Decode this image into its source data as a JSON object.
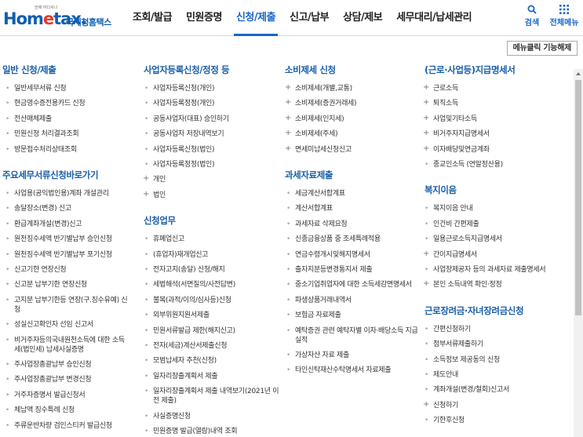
{
  "logo": {
    "tagline": "언제 어디서나",
    "main_prefix": "Hom",
    "main_accent": "e",
    "main_suffix": "tax.",
    "sub": "국세청홈택스"
  },
  "gnb": [
    "조회/발급",
    "민원증명",
    "신청/제출",
    "신고/납부",
    "상담/제보",
    "세무대리/납세관리"
  ],
  "gnb_active_index": 2,
  "utils": {
    "search": "검색",
    "all_menu": "전체메뉴"
  },
  "menu_click_button": "메뉴클릭 기능해제",
  "colors": {
    "brand": "#0f5fae",
    "accent_red": "#e8392b",
    "active": "#1a66c5",
    "section_title": "#1a5fa8"
  },
  "columns": [
    {
      "sections": [
        {
          "title": "일반 신청/제출",
          "items": [
            {
              "t": "일반세무서류 신청",
              "p": false
            },
            {
              "t": "현금영수증전용카드 신청",
              "p": false
            },
            {
              "t": "전산매체제출",
              "p": false
            },
            {
              "t": "민원신청 처리결과조회",
              "p": false
            },
            {
              "t": "방문접수처리상태조회",
              "p": false
            }
          ]
        },
        {
          "title": "주요세무서류신청바로가기",
          "items": [
            {
              "t": "사업용(공익법인용)계좌 개설관리",
              "p": false
            },
            {
              "t": "송달장소(변경) 신고",
              "p": false
            },
            {
              "t": "환급계좌개설(변경)신고",
              "p": false
            },
            {
              "t": "원천징수세액 반기별납부 승인신청",
              "p": false
            },
            {
              "t": "원천징수세액 반기별납부 포기신청",
              "p": false
            },
            {
              "t": "신고기한 연장신청",
              "p": false
            },
            {
              "t": "신고분 납부기한 연장신청",
              "p": false
            },
            {
              "t": "고지분 납부기한등 연장(구.징수유예) 신청",
              "p": false
            },
            {
              "t": "성실신고확인자 선임 신고서",
              "p": false
            },
            {
              "t": "비거주자등의국내원천소득에 대한 소득세(법인세) 납세사실증명",
              "p": false
            },
            {
              "t": "주사업장총괄납부 승인신청",
              "p": false
            },
            {
              "t": "주사업장총괄납부 변경신청",
              "p": false
            },
            {
              "t": "거주자증명서 발급신청서",
              "p": false
            },
            {
              "t": "체납액 징수특례 신청",
              "p": false
            },
            {
              "t": "주류운반차량 검인스티커 발급신청",
              "p": false
            }
          ]
        }
      ]
    },
    {
      "sections": [
        {
          "title": "사업자등록신청/정정 등",
          "items": [
            {
              "t": "사업자등록신청(개인)",
              "p": false
            },
            {
              "t": "사업자등록정정(개인)",
              "p": false
            },
            {
              "t": "공동사업자(대표) 승인하기",
              "p": false
            },
            {
              "t": "공동사업자 저장내역보기",
              "p": false
            },
            {
              "t": "사업자등록신청(법인)",
              "p": false
            },
            {
              "t": "사업자등록정정(법인)",
              "p": false
            },
            {
              "t": "개인",
              "p": true
            },
            {
              "t": "법인",
              "p": true
            }
          ]
        },
        {
          "title": "신청업무",
          "items": [
            {
              "t": "휴폐업신고",
              "p": false
            },
            {
              "t": "(휴업자)재개업신고",
              "p": false
            },
            {
              "t": "전자고지(송달) 신청/해지",
              "p": false
            },
            {
              "t": "세법해석(서면질의/사전답변)",
              "p": false
            },
            {
              "t": "불복(과적/이의/심사등)신청",
              "p": false
            },
            {
              "t": "외부위원지원서제출",
              "p": false
            },
            {
              "t": "민원서류발급 제한(해지신고)",
              "p": false
            },
            {
              "t": "전자(세금)계산서제출신청",
              "p": false
            },
            {
              "t": "모범납세자 추천(신청)",
              "p": false
            },
            {
              "t": "일자리창출계획서 제출",
              "p": false
            },
            {
              "t": "일자리창출계획서 제출 내역보기(2021년 이전 제출)",
              "p": false
            },
            {
              "t": "사실증명신청",
              "p": false
            },
            {
              "t": "민원증명 발급(열람)내역 조회",
              "p": false
            }
          ]
        }
      ]
    },
    {
      "sections": [
        {
          "title": "소비제세 신청",
          "items": [
            {
              "t": "소비제세(개별,교통)",
              "p": true
            },
            {
              "t": "소비제세(증권거래세)",
              "p": true
            },
            {
              "t": "소비제세(인지세)",
              "p": true
            },
            {
              "t": "소비제세(주세)",
              "p": true
            },
            {
              "t": "면세미납세신청신고",
              "p": true
            }
          ]
        },
        {
          "title": "과세자료제출",
          "items": [
            {
              "t": "세금계산서합계표",
              "p": false
            },
            {
              "t": "계산서합계표",
              "p": false
            },
            {
              "t": "과세자료 삭제요청",
              "p": false
            },
            {
              "t": "신종금융상품 중 조세특례적용",
              "p": false
            },
            {
              "t": "연금수령개시및해지명세서",
              "p": false
            },
            {
              "t": "출자지분등변경통지서 제출",
              "p": false
            },
            {
              "t": "중소기업취업자에 대한 소득세감면명세서",
              "p": false
            },
            {
              "t": "파생상품거래내역서",
              "p": false
            },
            {
              "t": "보험금 자료제출",
              "p": false
            },
            {
              "t": "예탁증권 관련 예탁자별 이자·배당소득 지급 실적",
              "p": false
            },
            {
              "t": "가상자산 자료 제출",
              "p": false
            },
            {
              "t": "타인신탁재산수탁명세서 자료제출",
              "p": false
            }
          ]
        }
      ]
    },
    {
      "sections": [
        {
          "title": "(근로·사업등)지급명세서",
          "items": [
            {
              "t": "근로소득",
              "p": true
            },
            {
              "t": "퇴직소득",
              "p": true
            },
            {
              "t": "사업및기타소득",
              "p": true
            },
            {
              "t": "비거주자지급명세서",
              "p": true
            },
            {
              "t": "이자배당및연금계좌",
              "p": true
            },
            {
              "t": "종교인소득 (연말정산용)",
              "p": false
            }
          ]
        },
        {
          "title": "복지이음",
          "items": [
            {
              "t": "복지이음 안내",
              "p": false
            },
            {
              "t": "인건비 간편제출",
              "p": false
            },
            {
              "t": "일용근로소득지급명세서",
              "p": false
            },
            {
              "t": "간이지급명세서",
              "p": true
            },
            {
              "t": "사업장제공자 등의 과세자료 제출명세서",
              "p": false
            },
            {
              "t": "본인 소득내역 확인·정정",
              "p": true
            }
          ]
        },
        {
          "title": "근로장려금·자녀장려금신청",
          "items": [
            {
              "t": "간편신청하기",
              "p": false
            },
            {
              "t": "첨부서류제출하기",
              "p": false
            },
            {
              "t": "소득정보 제공동의 신청",
              "p": false
            },
            {
              "t": "제도안내",
              "p": false
            },
            {
              "t": "계좌개설(변경/철회)신고서",
              "p": false
            },
            {
              "t": "신청하기",
              "p": true
            },
            {
              "t": "기한후신청",
              "p": false
            }
          ]
        }
      ]
    }
  ]
}
